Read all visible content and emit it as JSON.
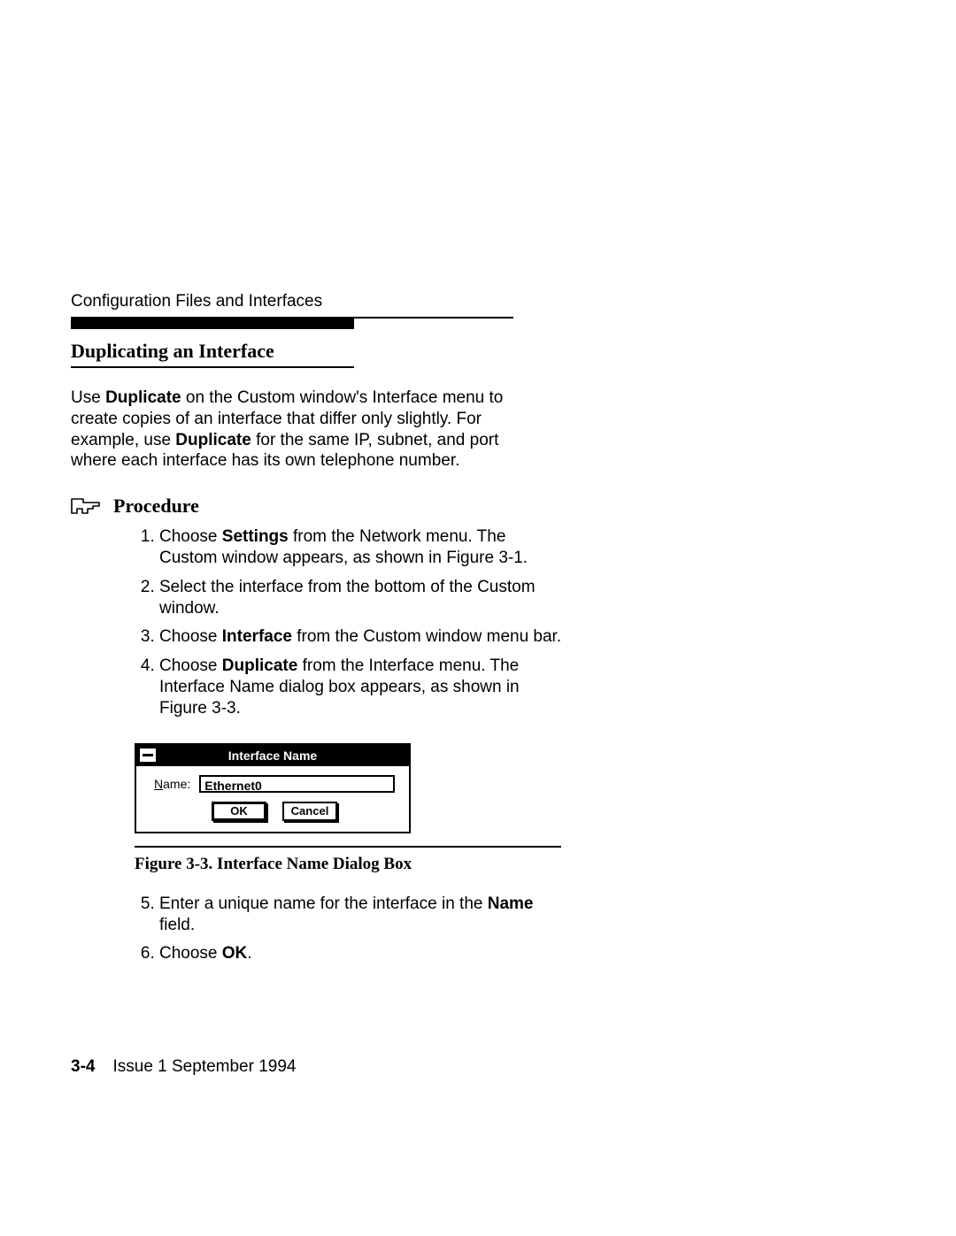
{
  "runningHead": "Configuration Files and Interfaces",
  "sectionHeading": "Duplicating an Interface",
  "intro": {
    "pre1": "Use ",
    "b1": "Duplicate",
    "mid1": " on the Custom window's Interface menu to create copies of an interface that differ only slightly. For example, use ",
    "b2": "Duplicate",
    "post1": " for the same IP, subnet, and port where each interface has its own telephone number."
  },
  "procedureLabel": "Procedure",
  "steps1": {
    "s1a": "Choose ",
    "s1b": "Settings",
    "s1c": " from the Network menu. The Custom window appears, as shown in Figure 3-1.",
    "s2": "Select the interface from the bottom of the Custom window.",
    "s3a": "Choose ",
    "s3b": "Interface",
    "s3c": " from the Custom window menu bar.",
    "s4a": "Choose ",
    "s4b": "Duplicate",
    "s4c": " from the Interface menu. The Interface Name dialog box appears, as shown in Figure 3-3."
  },
  "dialog": {
    "title": "Interface Name",
    "labelPrefix": "N",
    "labelRest": "ame:",
    "value": "Ethernet0",
    "ok": "OK",
    "cancel": "Cancel"
  },
  "figCaption": "Figure 3-3.  Interface Name Dialog Box",
  "steps2": {
    "s5a": "Enter a unique name for the interface in the ",
    "s5b": "Name",
    "s5c": " field.",
    "s6a": "Choose ",
    "s6b": "OK",
    "s6c": "."
  },
  "footer": {
    "pageNum": "3-4",
    "issue": "Issue 1  September 1994"
  }
}
